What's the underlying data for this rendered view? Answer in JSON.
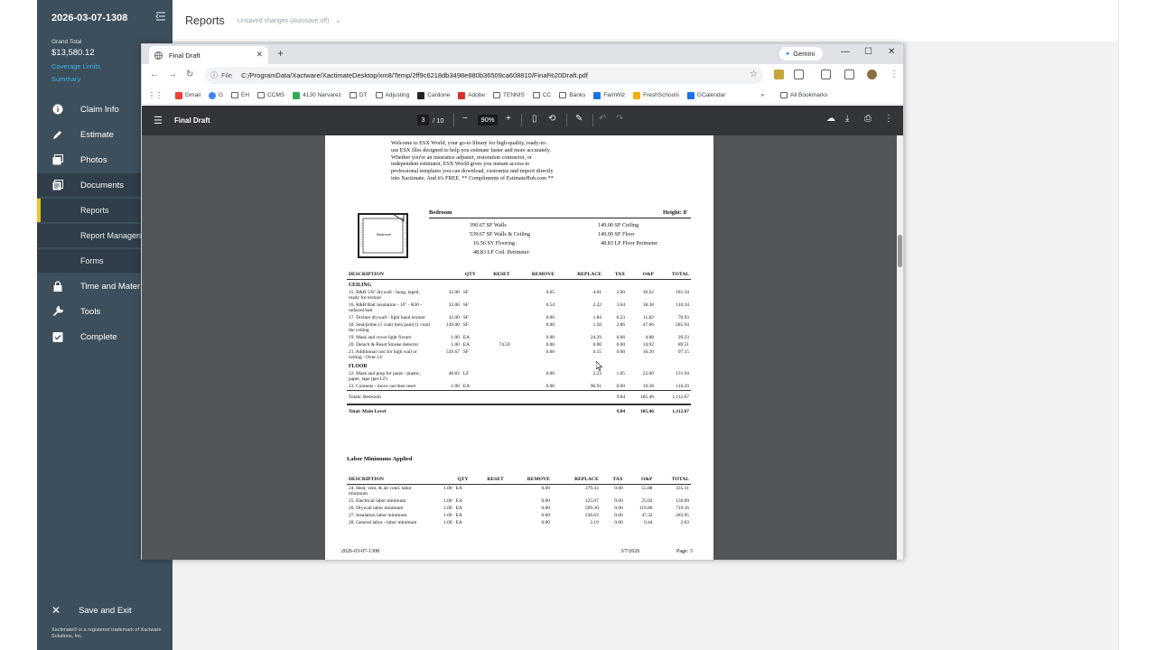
{
  "sidebar": {
    "claim_id": "2026-03-07-1308",
    "grand_total_label": "Grand Total",
    "grand_total_value": "$13,580.12",
    "coverage_limits": "Coverage Limits",
    "summary": "Summary",
    "nav": [
      {
        "label": "Claim Info",
        "icon": "info-icon"
      },
      {
        "label": "Estimate",
        "icon": "pencil-icon"
      },
      {
        "label": "Photos",
        "icon": "photos-icon"
      },
      {
        "label": "Documents",
        "icon": "documents-icon"
      },
      {
        "label": "Reports"
      },
      {
        "label": "Report Managen"
      },
      {
        "label": "Forms"
      },
      {
        "label": "Time and Mater",
        "icon": "lock-icon"
      },
      {
        "label": "Tools",
        "icon": "wrench-icon"
      },
      {
        "label": "Complete",
        "icon": "check-icon"
      }
    ],
    "save_exit": "Save and Exit",
    "trademark": "Xactimate® is a registered trademark of Xactware Solutions, Inc."
  },
  "main": {
    "title": "Reports",
    "unsaved": "Unsaved changes (Autosave off)"
  },
  "browser": {
    "tab_title": "Final Draft",
    "gemini": "Gemini",
    "file_label": "File",
    "url": "C:/ProgramData/Xactware/XactimateDesktop/xm8/Temp/2ff9c6218db3498e880b36509ca608810/Final%20Draft.pdf",
    "bookmarks": [
      "Gmail",
      "G",
      "EH",
      "CCMS",
      "4130 Narvarez",
      "DT",
      "Adjusting",
      "Cardone",
      "Adobe",
      "TENNIS",
      "CC",
      "Banks",
      "FamWiz",
      "FreshSchools",
      "GCalendar"
    ],
    "all_bookmarks": "All Bookmarks",
    "colors": {
      "tabbar": "#dfe3e8",
      "pdf_toolbar": "#323639",
      "pdf_bg": "#525659"
    }
  },
  "pdf": {
    "title": "Final Draft",
    "page": "3",
    "page_of": "/ 10",
    "zoom": "90%",
    "intro": "Welcome to ESX World, your go-to library for high-quality, ready-to-use ESX files designed to help you estimate faster and more accurately. Whether you're an insurance adjuster, restoration contractor, or independent estimator, ESX World gives you instant access to professional templates you can download, customize and import directly into Xactimate. And it's FREE.  ** Compliments of EstimateHub.com **",
    "room_label": "Bedroom",
    "room_title": "Bedroom",
    "room_height": "Height: 8'",
    "measurements_left": [
      "390.67  SF Walls",
      "539.67  SF Walls & Ceiling",
      "16.56  SY Flooring",
      "48.83  LF Ceil. Perimeter"
    ],
    "measurements_right": [
      "149.00  SF Ceiling",
      "149.00  SF Floor",
      "48.83  LF Floor Perimeter"
    ],
    "columns": [
      "DESCRIPTION",
      "QTY",
      "RESET",
      "REMOVE",
      "REPLACE",
      "TAX",
      "O&P",
      "TOTAL"
    ],
    "group_ceiling": "CEILING",
    "group_floor": "FLOOR",
    "rows_ceiling": [
      {
        "desc": "15.  R&R 5/8\" drywall - hung, taped, ready for texture",
        "qty": "32.00",
        "unit": "SF",
        "reset": "",
        "remove": "0.65",
        "replace": "4.01",
        "tax": "2.00",
        "op": "30.22",
        "total": "181.34"
      },
      {
        "desc": "16.  R&R Batt insulation - 10\" - R30 - unfaced batt",
        "qty": "32.00",
        "unit": "SF",
        "reset": "",
        "remove": "0.54",
        "replace": "2.22",
        "tax": "3.64",
        "op": "18.38",
        "total": "110.34"
      },
      {
        "desc": "17.  Texture drywall - light hand texture",
        "qty": "32.00",
        "unit": "SF",
        "reset": "",
        "remove": "0.00",
        "replace": "1.84",
        "tax": "0.23",
        "op": "11.82",
        "total": "70.93"
      },
      {
        "desc": "18.  Seal/prime (1 coat) then paint (1 coat) the ceiling",
        "qty": "149.00",
        "unit": "SF",
        "reset": "",
        "remove": "0.00",
        "replace": "1.58",
        "tax": "2.86",
        "op": "47.66",
        "total": "285.94"
      },
      {
        "desc": "19.  Mask and cover light fixture",
        "qty": "1.00",
        "unit": "EA",
        "reset": "",
        "remove": "0.00",
        "replace": "24.29",
        "tax": "0.06",
        "op": "4.88",
        "total": "29.23"
      },
      {
        "desc": "20.  Detach & Reset Smoke detector",
        "qty": "1.00",
        "unit": "EA",
        "reset": "74.59",
        "remove": "0.00",
        "replace": "0.00",
        "tax": "0.00",
        "op": "14.92",
        "total": "89.51"
      },
      {
        "desc": "21.  Additional cost for high wall or ceiling - Over 14'",
        "qty": "539.67",
        "unit": "SF",
        "reset": "",
        "remove": "0.00",
        "replace": "0.15",
        "tax": "0.00",
        "op": "16.20",
        "total": "97.15"
      }
    ],
    "rows_floor": [
      {
        "desc": "22.  Mask and prep for paint - plastic, paper, tape (per LF)",
        "qty": "48.83",
        "unit": "LF",
        "reset": "",
        "remove": "0.00",
        "replace": "2.23",
        "tax": "1.05",
        "op": "22.00",
        "total": "131.94"
      },
      {
        "desc": "23.  Contents - move out then reset",
        "qty": "1.00",
        "unit": "EA",
        "reset": "",
        "remove": "0.00",
        "replace": "96.91",
        "tax": "0.00",
        "op": "19.38",
        "total": "116.29"
      }
    ],
    "totals_bedroom": {
      "label": "Totals:  Bedroom",
      "tax": "9.84",
      "op": "185.46",
      "total": "1,112.67"
    },
    "totals_main": {
      "label": "Total: Main Level",
      "tax": "9.84",
      "op": "185.46",
      "total": "1,112.67"
    },
    "labor_title": "Labor Minimums Applied",
    "rows_labor": [
      {
        "desc": "24.  Heat, vent, & air cond. labor minimum",
        "qty": "1.00",
        "unit": "EA",
        "reset": "",
        "remove": "0.00",
        "replace": "279.43",
        "tax": "0.00",
        "op": "55.88",
        "total": "335.31"
      },
      {
        "desc": "25.  Electrical labor minimum",
        "qty": "1.00",
        "unit": "EA",
        "reset": "",
        "remove": "0.00",
        "replace": "125.07",
        "tax": "0.00",
        "op": "25.02",
        "total": "150.09"
      },
      {
        "desc": "26.  Drywall labor minimum",
        "qty": "1.00",
        "unit": "EA",
        "reset": "",
        "remove": "0.00",
        "replace": "599.30",
        "tax": "0.00",
        "op": "119.86",
        "total": "719.16"
      },
      {
        "desc": "27.  Insulation labor minimum",
        "qty": "1.00",
        "unit": "EA",
        "reset": "",
        "remove": "0.00",
        "replace": "236.63",
        "tax": "0.00",
        "op": "47.32",
        "total": "283.95"
      },
      {
        "desc": "28.  General labor - labor minimum",
        "qty": "1.00",
        "unit": "EA",
        "reset": "",
        "remove": "0.00",
        "replace": "2.19",
        "tax": "0.00",
        "op": "0.44",
        "total": "2.63"
      }
    ],
    "footer_id": "2026-03-07-1308",
    "footer_date": "3/7/2026",
    "footer_page": "Page: 3"
  }
}
